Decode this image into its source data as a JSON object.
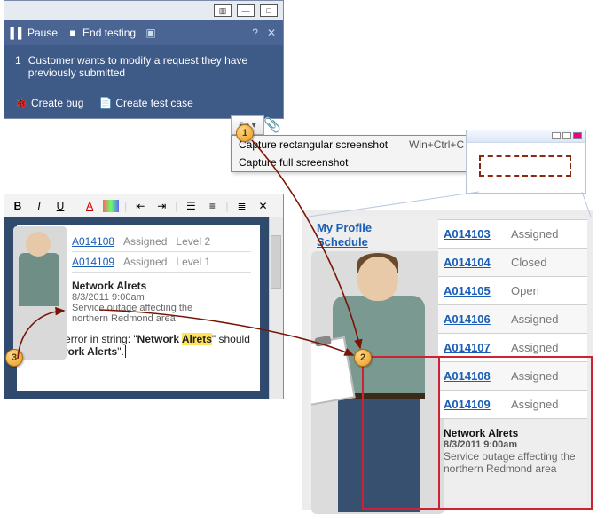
{
  "runner": {
    "pause": "Pause",
    "end": "End testing",
    "step_no": "1",
    "step_text": "Customer wants to modify a request they have previously submitted",
    "create_bug": "Create bug",
    "create_test": "Create test case"
  },
  "capture": {
    "items": [
      {
        "label": "Capture rectangular screenshot",
        "accel": "Win+Ctrl+C"
      },
      {
        "label": "Capture full screenshot",
        "accel": ""
      }
    ]
  },
  "editor": {
    "rows": [
      {
        "id": "A014108",
        "status": "Assigned",
        "level": "Level 2"
      },
      {
        "id": "A014109",
        "status": "Assigned",
        "level": "Level 1"
      }
    ],
    "alert": {
      "title": "Network Alrets",
      "date": "8/3/2011 9:00am",
      "msg": "Service outage affecting the northern Redmond area"
    },
    "note_pre": "Spelling error in string: \"",
    "note_err": "Network ",
    "note_err_hl": "Alrets",
    "note_mid": "\" should be \"",
    "note_fix": "Network Alerts",
    "note_post": "\"."
  },
  "app": {
    "links": {
      "profile": "My Profile",
      "schedule": "Schedule"
    },
    "rows": [
      {
        "id": "A014103",
        "status": "Assigned"
      },
      {
        "id": "A014104",
        "status": "Closed"
      },
      {
        "id": "A014105",
        "status": "Open"
      },
      {
        "id": "A014106",
        "status": "Assigned"
      },
      {
        "id": "A014107",
        "status": "Assigned"
      },
      {
        "id": "A014108",
        "status": "Assigned"
      },
      {
        "id": "A014109",
        "status": "Assigned"
      }
    ],
    "alert": {
      "title": "Network Alrets",
      "date": "8/3/2011 9:00am",
      "msg": "Service outage affecting the northern Redmond area"
    }
  },
  "markers": {
    "m1": "1",
    "m2": "2",
    "m3": "3"
  }
}
